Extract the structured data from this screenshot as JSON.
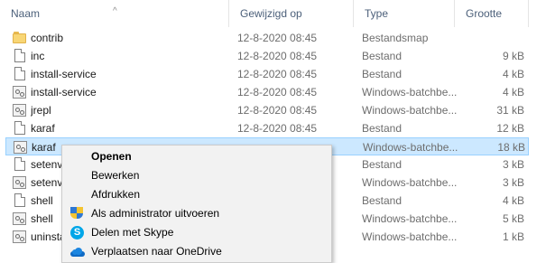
{
  "columns": {
    "name": "Naam",
    "modified": "Gewijzigd op",
    "type": "Type",
    "size": "Grootte"
  },
  "files": [
    {
      "name": "contrib",
      "date": "12-8-2020 08:45",
      "type": "Bestandsmap",
      "size": "",
      "icon": "folder-icon"
    },
    {
      "name": "inc",
      "date": "12-8-2020 08:45",
      "type": "Bestand",
      "size": "9 kB",
      "icon": "file-icon"
    },
    {
      "name": "install-service",
      "date": "12-8-2020 08:45",
      "type": "Bestand",
      "size": "4 kB",
      "icon": "file-icon"
    },
    {
      "name": "install-service",
      "date": "12-8-2020 08:45",
      "type": "Windows-batchbe...",
      "size": "4 kB",
      "icon": "batch-file-icon"
    },
    {
      "name": "jrepl",
      "date": "12-8-2020 08:45",
      "type": "Windows-batchbe...",
      "size": "31 kB",
      "icon": "batch-file-icon"
    },
    {
      "name": "karaf",
      "date": "12-8-2020 08:45",
      "type": "Bestand",
      "size": "12 kB",
      "icon": "file-icon"
    },
    {
      "name": "karaf",
      "date": "",
      "type": "Windows-batchbe...",
      "size": "18 kB",
      "icon": "batch-file-icon"
    },
    {
      "name": "setenv",
      "date": "",
      "type": "Bestand",
      "size": "3 kB",
      "icon": "file-icon"
    },
    {
      "name": "setenv",
      "date": "",
      "type": "Windows-batchbe...",
      "size": "3 kB",
      "icon": "batch-file-icon"
    },
    {
      "name": "shell",
      "date": "",
      "type": "Bestand",
      "size": "4 kB",
      "icon": "file-icon"
    },
    {
      "name": "shell",
      "date": "",
      "type": "Windows-batchbe...",
      "size": "5 kB",
      "icon": "batch-file-icon"
    },
    {
      "name": "uninsta",
      "date": "",
      "type": "Windows-batchbe...",
      "size": "1 kB",
      "icon": "batch-file-icon"
    }
  ],
  "selected_row": 6,
  "context_menu": {
    "items": [
      {
        "label": "Openen",
        "bold": true,
        "icon": ""
      },
      {
        "label": "Bewerken",
        "bold": false,
        "icon": ""
      },
      {
        "label": "Afdrukken",
        "bold": false,
        "icon": ""
      },
      {
        "label": "Als administrator uitvoeren",
        "bold": false,
        "icon": "uac-shield-icon"
      },
      {
        "label": "Delen met Skype",
        "bold": false,
        "icon": "skype-icon"
      },
      {
        "label": "Verplaatsen naar OneDrive",
        "bold": false,
        "icon": "onedrive-icon"
      }
    ]
  },
  "colors": {
    "selection": "#cce8ff",
    "selection_border": "#99d1ff",
    "header_text": "#4c607a",
    "menu_background": "#f2f2f2"
  }
}
